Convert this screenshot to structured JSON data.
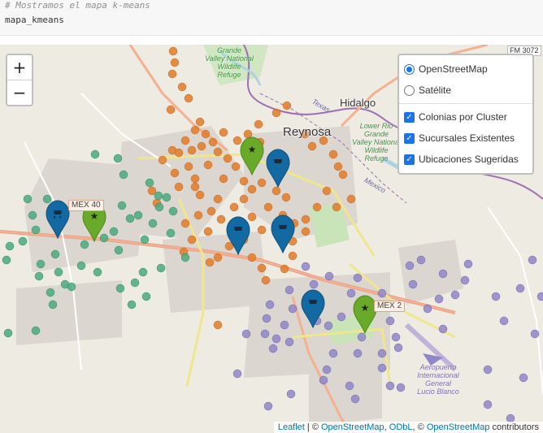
{
  "code": {
    "comment": "# Mostramos el mapa k-means",
    "command": "mapa_kmeans"
  },
  "map": {
    "zoom_in": "+",
    "zoom_out": "−",
    "labels": {
      "city": "Reynosa",
      "hidalgo": "Hidalgo",
      "texas": "Texas",
      "mexico": "Mexico",
      "refuge_1": [
        "Grande",
        "Valley National",
        "Wildlife",
        "Refuge"
      ],
      "refuge_2": [
        "Lower Rio",
        "Grande",
        "Valley National",
        "Wildlife",
        "Refuge"
      ],
      "airport": [
        "Aeropuerto",
        "Internacional",
        "General",
        "Lucio Blanco"
      ],
      "road_1": "MEX 40",
      "road_2": "MEX 2",
      "road_3": "FM 3072"
    },
    "layers": {
      "base_1": "OpenStreetMap",
      "base_2": "Satélite",
      "overlay_1": "Colonias por Cluster",
      "overlay_2": "Sucursales Existentes",
      "overlay_3": "Ubicaciones Sugeridas",
      "selected_base": "OpenStreetMap"
    },
    "attribution": {
      "leaflet": "Leaflet",
      "sep1": " | © ",
      "osm": "OpenStreetMap",
      "sep2": ", ",
      "odbl": "ODbL",
      "sep3": ", © ",
      "osm2": "OpenStreetMap",
      "suffix": " contributors"
    },
    "colors": {
      "cluster_orange": "#e07b2a",
      "cluster_green": "#4aaa7e",
      "cluster_purple": "#8f86c9",
      "existing_marker": "#136aa3",
      "suggested_marker": "#6aaa2a"
    }
  }
}
